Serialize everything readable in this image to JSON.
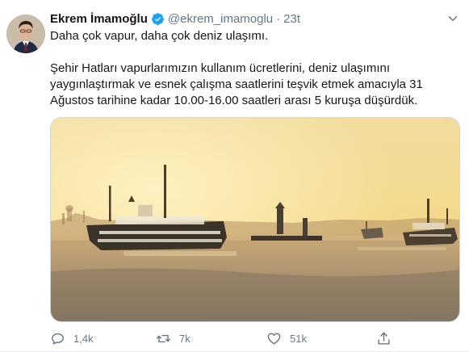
{
  "tweet": {
    "author_name": "Ekrem İmamoğlu",
    "handle": "@ekrem_imamoglu",
    "separator": "·",
    "time": "23t",
    "text_line1": "Daha çok vapur, daha çok deniz ulaşımı.",
    "text_para2": "Şehir Hatları vapurlarımızın kullanım ücretlerini, deniz ulaşımını yaygınlaştırmak ve esnek çalışma saatlerini teşvik etmek amacıyla 31 Ağustos tarihine kadar 10.00-16.00 saatleri arası 5 kuruşa düşürdük."
  },
  "icons": {
    "verified": "verified-badge-icon",
    "caret": "chevron-down-icon",
    "reply": "reply-icon",
    "retweet": "retweet-icon",
    "like": "heart-icon",
    "share": "share-icon"
  },
  "actions": {
    "reply_count": "1,4k",
    "retweet_count": "7k",
    "like_count": "51k"
  },
  "colors": {
    "verified_blue": "#1da1f2",
    "muted_text": "#657786"
  }
}
